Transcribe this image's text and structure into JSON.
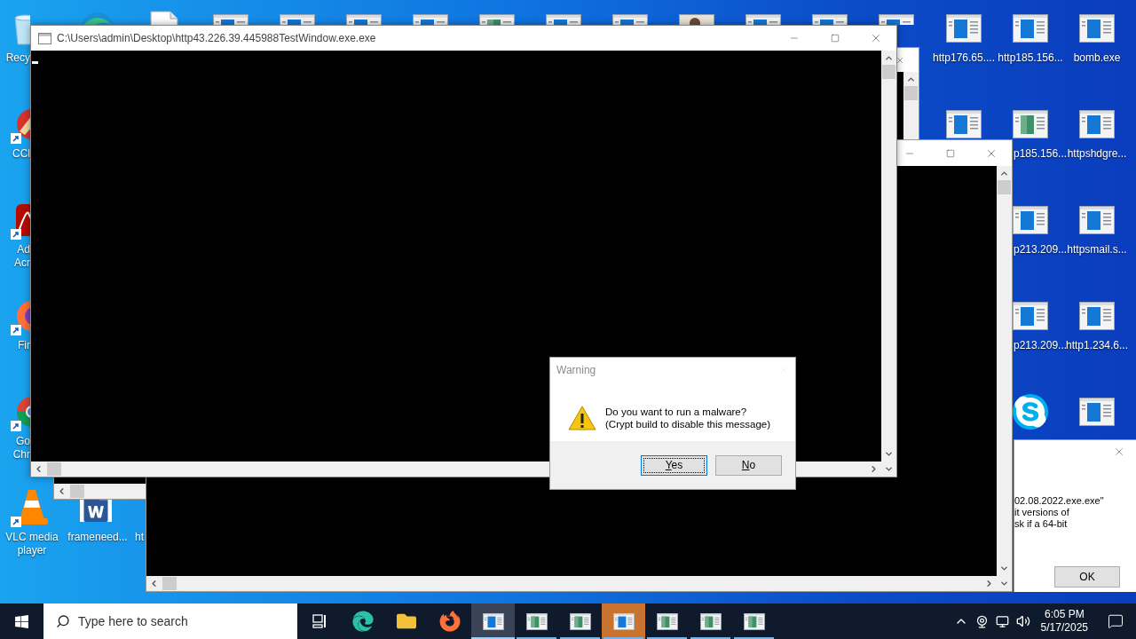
{
  "desktop_icons": [
    {
      "kind": "recycle",
      "label": "Recy",
      "shortcut": false
    },
    {
      "kind": "edge",
      "shortcut": false
    },
    {
      "kind": "document",
      "shortcut": false
    },
    {
      "kind": "app",
      "shortcut": false
    },
    {
      "kind": "app",
      "shortcut": false
    },
    {
      "kind": "app",
      "shortcut": false
    },
    {
      "kind": "app",
      "shortcut": false
    },
    {
      "kind": "app-picture",
      "shortcut": false
    },
    {
      "kind": "app",
      "shortcut": false
    },
    {
      "kind": "app",
      "shortcut": false
    },
    {
      "kind": "photo",
      "shortcut": false
    },
    {
      "kind": "app",
      "shortcut": false
    },
    {
      "kind": "app",
      "shortcut": false
    },
    {
      "kind": "app",
      "shortcut": false
    },
    {
      "kind": "app",
      "label": "http176.65....",
      "shortcut": false
    },
    {
      "kind": "app",
      "label": "http185.156...",
      "shortcut": false
    },
    {
      "kind": "app",
      "label": "bomb.exe",
      "shortcut": false
    },
    {
      "kind": "ccleaner",
      "label": "CCl",
      "shortcut": true
    },
    {
      "kind": "app",
      "shortcut": false
    },
    {
      "kind": "app-picture",
      "label": "p185.156...",
      "shortcut": false
    },
    {
      "kind": "app",
      "label": "httpshdgre...",
      "shortcut": false
    },
    {
      "kind": "acrobat",
      "label": "Ad Acr",
      "shortcut": true
    },
    {
      "kind": "app",
      "label": "p213.209...",
      "shortcut": false
    },
    {
      "kind": "app",
      "label": "httpsmail.s...",
      "shortcut": false
    },
    {
      "kind": "firefox",
      "label": "Fir",
      "shortcut": true
    },
    {
      "kind": "app",
      "label": "p213.209...",
      "shortcut": false
    },
    {
      "kind": "app",
      "label": "http1.234.6...",
      "shortcut": false
    },
    {
      "kind": "chrome",
      "label": "Go Chr",
      "shortcut": true
    },
    {
      "kind": "skype",
      "shortcut": false
    },
    {
      "kind": "app",
      "shortcut": false
    },
    {
      "kind": "vlc",
      "label": "VLC media player",
      "shortcut": true
    },
    {
      "kind": "word",
      "label": "frameneed...",
      "shortcut": false
    },
    {
      "label": "ht",
      "shortcut": false
    }
  ],
  "console_window": {
    "title": "C:\\Users\\admin\\Desktop\\http43.226.39.445988TestWindow.exe.exe"
  },
  "dialog": {
    "title": "Warning",
    "active": false,
    "message": [
      "Do you want to run a malware?",
      "(Crypt build to disable this message)"
    ],
    "buttons": [
      {
        "label": "Yes",
        "focused": true
      },
      {
        "label": "No",
        "focused": false
      }
    ]
  },
  "message_box": {
    "lines": [
      "02.08.2022.exe.exe\"",
      "it versions of",
      "sk if a 64-bit"
    ],
    "button": "OK"
  },
  "taskbar": {
    "search_placeholder": "Type here to search",
    "items": [
      {
        "kind": "task-view",
        "active": false,
        "flashing": false
      },
      {
        "kind": "edge",
        "active": false,
        "flashing": false
      },
      {
        "kind": "explorer",
        "active": false,
        "flashing": false
      },
      {
        "kind": "firefox",
        "active": false,
        "flashing": false
      },
      {
        "kind": "app",
        "active": true,
        "flashing": false
      },
      {
        "kind": "app-picture",
        "active": false,
        "flashing": false
      },
      {
        "kind": "app-picture",
        "active": false,
        "flashing": false
      },
      {
        "kind": "app",
        "active": false,
        "flashing": true
      },
      {
        "kind": "app-picture",
        "active": false,
        "flashing": false
      },
      {
        "kind": "app-picture",
        "active": false,
        "flashing": false
      },
      {
        "kind": "app-picture",
        "active": false,
        "flashing": false
      }
    ],
    "clock": {
      "time": "6:05 PM",
      "date": "5/17/2025"
    }
  }
}
